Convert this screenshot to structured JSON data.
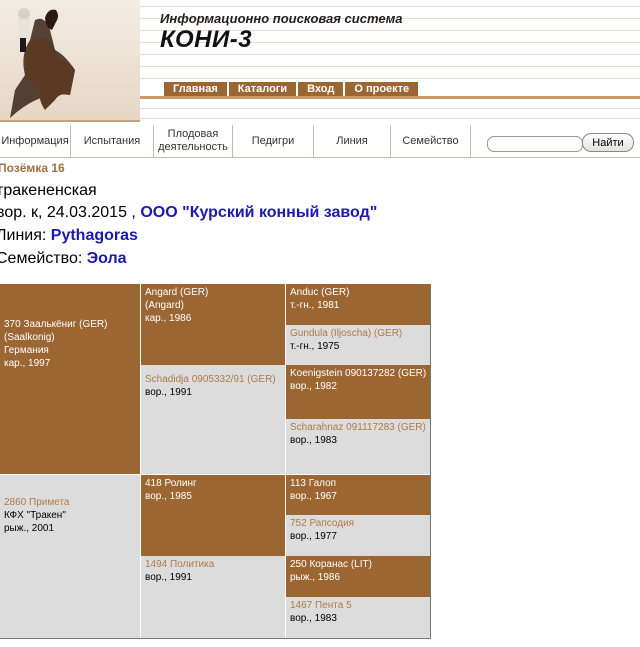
{
  "header": {
    "system_subtitle": "Информационно поисковая система",
    "system_title": "КОНИ-3",
    "top_nav": [
      "Главная",
      "Каталоги",
      "Вход",
      "О проекте"
    ]
  },
  "nav": {
    "items": [
      "Информация",
      "Испытания",
      "Плодовая деятельность",
      "Педигри",
      "Линия",
      "Семейство"
    ],
    "search_placeholder": "",
    "find_label": "Найти"
  },
  "horse": {
    "name": "Позёмка 16",
    "breed": "тракененская",
    "details": "вор. к, 24.03.2015 ,",
    "owner": "ООО \"Курский конный завод\"",
    "line_label": "Линия:",
    "line_value": "Pythagoras",
    "family_label": "Семейство:",
    "family_value": "Эола"
  },
  "pedigree": {
    "sire": {
      "name": "370 Заалькёниг (GER)",
      "alt": "(Saalkonig)",
      "country": "Германия",
      "info": "кар., 1997"
    },
    "dam": {
      "name": "2860 Примета",
      "breeder": "КФХ \"Тракен\"",
      "info": "рыж., 2001"
    },
    "ss": {
      "name": "Angard (GER)",
      "alt": "(Angard)",
      "info": "кар., 1986"
    },
    "sd": {
      "name": "Schadidja 0905332/91 (GER)",
      "info": "вор., 1991"
    },
    "ds": {
      "name": "418 Ролинг",
      "info": "вор., 1985"
    },
    "dd": {
      "name": "1494 Политика",
      "info": "вор., 1991"
    },
    "sss": {
      "name": "Anduc (GER)",
      "info": "т.-гн., 1981"
    },
    "ssd": {
      "name": "Gundula (Iljoscha) (GER)",
      "info": "т.-гн., 1975"
    },
    "sds": {
      "name": "Koenigstein 090137282 (GER)",
      "info": "вор., 1982"
    },
    "sdd": {
      "name": "Scharahnaz 091117283 (GER)",
      "info": "вор., 1983"
    },
    "dss": {
      "name": "113 Галоп",
      "info": "вор., 1967"
    },
    "dsd": {
      "name": "752 Рапсодия",
      "info": "вор., 1977"
    },
    "dds": {
      "name": "250 Коранас (LIT)",
      "info": "рыж., 1986"
    },
    "ddd": {
      "name": "1467 Пента 5",
      "info": "вор., 1983"
    }
  },
  "colors": {
    "brown": "#9c6633",
    "gray": "#dcdcdc",
    "link": "#1a1ab0"
  }
}
